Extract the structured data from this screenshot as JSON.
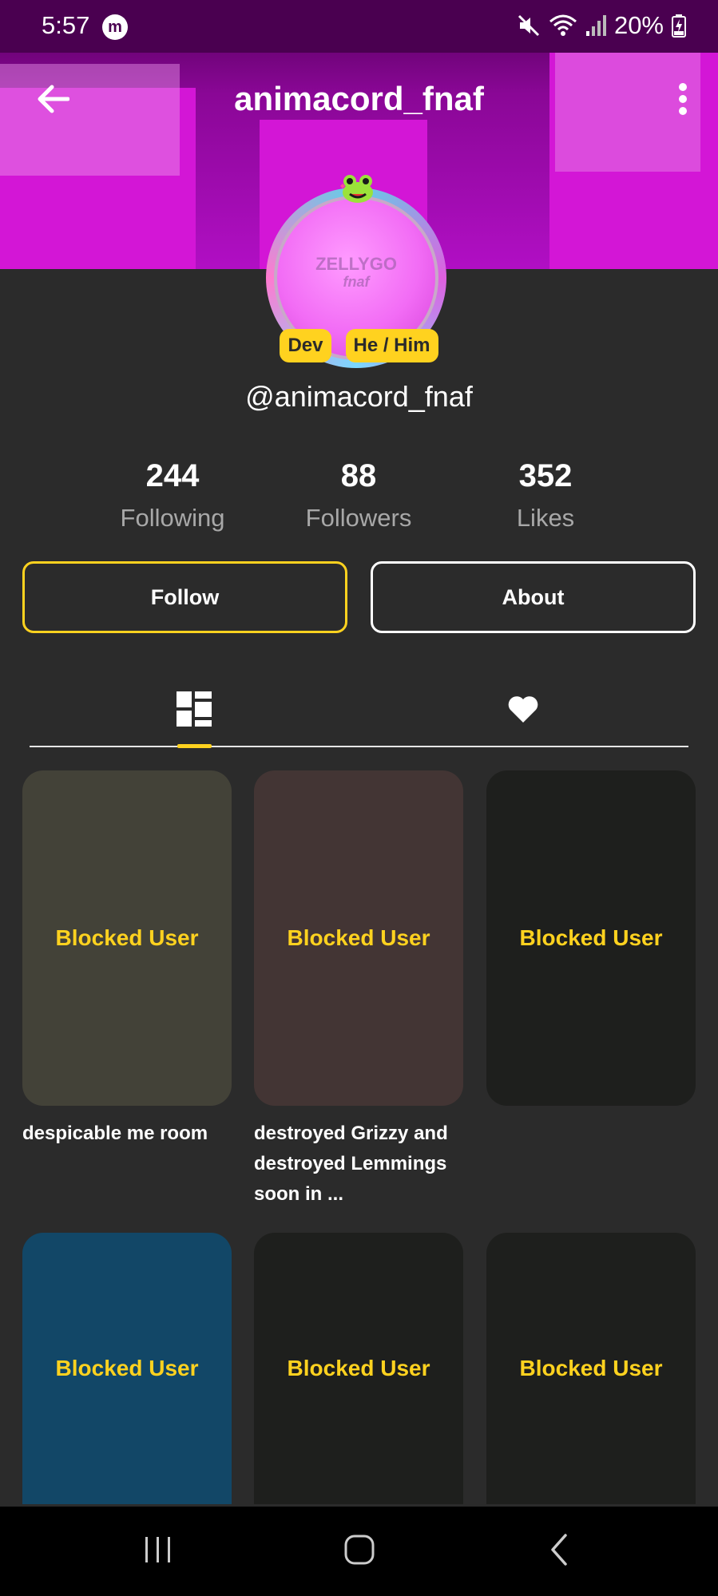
{
  "status_bar": {
    "time": "5:57",
    "app_badge": "m",
    "battery": "20%",
    "icons": [
      "mute-icon",
      "wifi-icon",
      "signal-icon",
      "battery-charging-icon"
    ]
  },
  "header": {
    "title": "animacord_fnaf",
    "back_icon": "arrow-left-icon",
    "menu_icon": "more-vertical-icon",
    "banner_color": "#b10fc4"
  },
  "profile": {
    "avatar_text": "ZELLYGO",
    "avatar_subtext": "fnaf",
    "badges": [
      "Dev",
      "He / Him"
    ],
    "handle": "@animacord_fnaf"
  },
  "stats": {
    "following": {
      "value": "244",
      "label": "Following"
    },
    "followers": {
      "value": "88",
      "label": "Followers"
    },
    "likes": {
      "value": "352",
      "label": "Likes"
    }
  },
  "actions": {
    "follow_label": "Follow",
    "about_label": "About"
  },
  "tabs": [
    {
      "name": "posts",
      "icon": "grid-icon",
      "active": true
    },
    {
      "name": "liked",
      "icon": "heart-icon",
      "active": false
    }
  ],
  "posts": [
    {
      "label": "Blocked User",
      "caption": "despicable me room",
      "color": "#434238"
    },
    {
      "label": "Blocked User",
      "caption": "destroyed Grizzy and destroyed Lemmings soon in ...",
      "color": "#433534"
    },
    {
      "label": "Blocked User",
      "caption": "",
      "color": "#1e1f1d"
    },
    {
      "label": "Blocked User",
      "caption": "",
      "color": "#124767"
    },
    {
      "label": "Blocked User",
      "caption": "",
      "color": "#1e1f1d"
    },
    {
      "label": "Blocked User",
      "caption": "",
      "color": "#1e1f1d"
    }
  ],
  "accent_color": "#ffd21f",
  "nav": {
    "icons": [
      "recents-icon",
      "home-icon",
      "back-icon"
    ]
  }
}
